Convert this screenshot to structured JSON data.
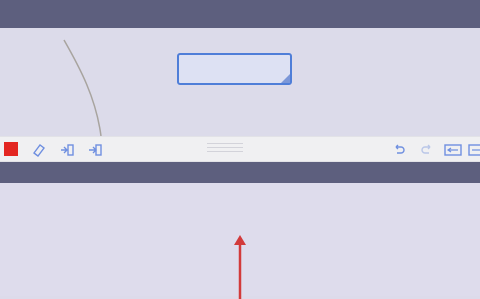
{
  "window": {
    "top_bar_color": "#5d5f7e",
    "canvas_color": "#dcdbea"
  },
  "canvas": {
    "text_box": {
      "value": "",
      "border_color": "#4f7ed8"
    },
    "stroke": {
      "color": "#a8a49f"
    }
  },
  "toolbar": {
    "tools": [
      {
        "name": "color-swatch",
        "color": "#e32621",
        "icon": "square"
      },
      {
        "name": "eraser",
        "icon": "eraser-icon"
      },
      {
        "name": "indent-in",
        "icon": "indent-in-icon"
      },
      {
        "name": "indent-out",
        "icon": "indent-out-icon"
      },
      {
        "name": "undo",
        "icon": "undo-icon"
      },
      {
        "name": "redo",
        "icon": "redo-icon"
      },
      {
        "name": "fit-width",
        "icon": "fit-width-icon"
      },
      {
        "name": "layout",
        "icon": "layout-icon"
      }
    ],
    "icon_color": "#6f8fe0"
  },
  "annotation": {
    "arrow_color": "#d23a3a"
  }
}
